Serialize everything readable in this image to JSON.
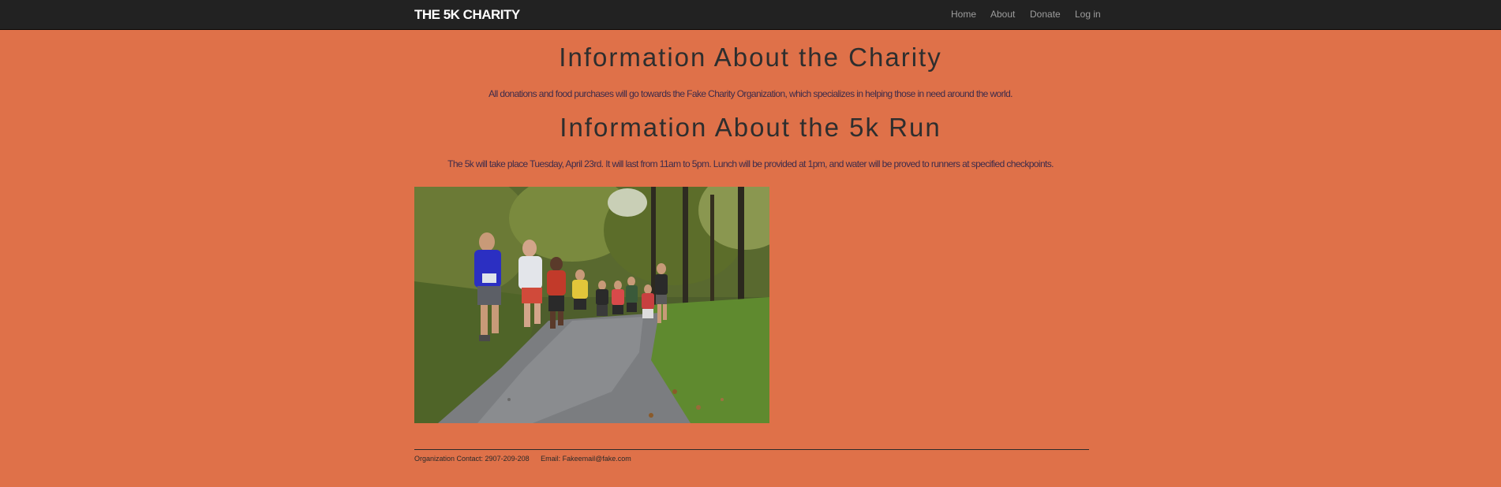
{
  "navbar": {
    "brand": "THE 5K CHARITY",
    "links": [
      {
        "label": "Home"
      },
      {
        "label": "About"
      },
      {
        "label": "Donate"
      },
      {
        "label": "Log in"
      }
    ]
  },
  "charity": {
    "heading": "Information About the Charity",
    "text": "All donations and food purchases will go towards the Fake Charity Organization, which specializes in helping those in need around the world."
  },
  "run": {
    "heading": "Information About the 5k Run",
    "text": "The 5k will take place Tuesday, April 23rd. It will last from 11am to 5pm. Lunch will be provided at 1pm, and water will be proved to runners at specified checkpoints."
  },
  "footer": {
    "contact": "Organization Contact: 2907-209-208",
    "email": "Email: Fakeemail@fake.com"
  },
  "colors": {
    "background": "#DF7149",
    "navbar": "#222222",
    "nav_link": "#9d9d9d"
  }
}
